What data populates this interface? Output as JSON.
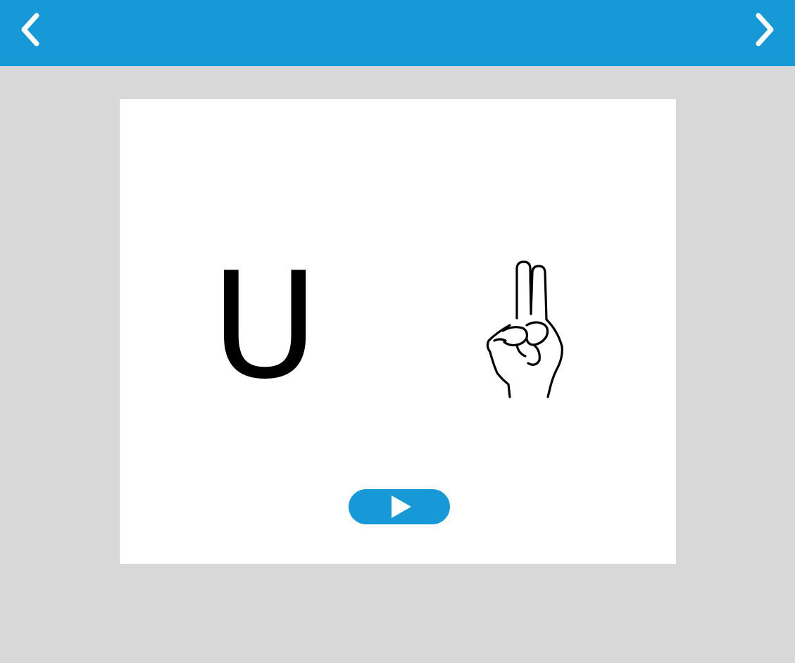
{
  "theme": {
    "accent": "#1699d6",
    "background": "#d8d8d8",
    "card": "#ffffff"
  },
  "nav": {
    "prev_icon": "chevron-left-icon",
    "next_icon": "chevron-right-icon"
  },
  "card": {
    "letter": "U",
    "sign_icon": "asl-letter-u-hand-icon",
    "play_icon": "play-icon"
  }
}
